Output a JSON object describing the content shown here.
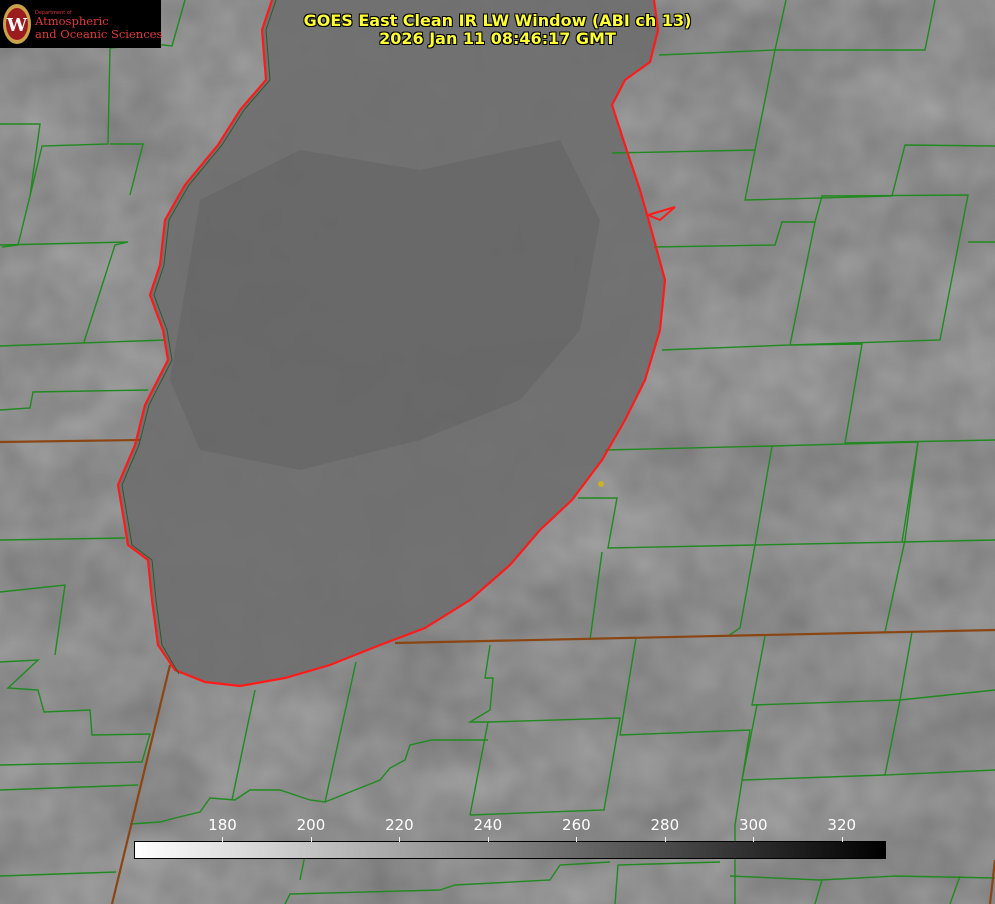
{
  "title": {
    "line1": "GOES East Clean IR LW Window (ABI ch 13)",
    "line2": "2026 Jan 11 08:46:17 GMT"
  },
  "logo": {
    "dept_small": "Department of",
    "line1": "Atmospheric",
    "line2": "and Oceanic Sciences",
    "seal_letter": "W",
    "seal_color": "#9b1b1f"
  },
  "colorbar": {
    "unit_range": [
      160,
      330
    ],
    "ticks": [
      {
        "value": 180,
        "label": "180"
      },
      {
        "value": 200,
        "label": "200"
      },
      {
        "value": 220,
        "label": "220"
      },
      {
        "value": 240,
        "label": "240"
      },
      {
        "value": 260,
        "label": "260"
      },
      {
        "value": 280,
        "label": "280"
      },
      {
        "value": 300,
        "label": "300"
      },
      {
        "value": 320,
        "label": "320"
      }
    ],
    "start_color": "#ffffff",
    "end_color": "#000000"
  },
  "colors": {
    "county_lines": "#1f8a1f",
    "coastline": "#ff1a1a",
    "state_border": "#8b4513",
    "title_text": "#ffff33",
    "city_marker": "#c9b22a"
  }
}
